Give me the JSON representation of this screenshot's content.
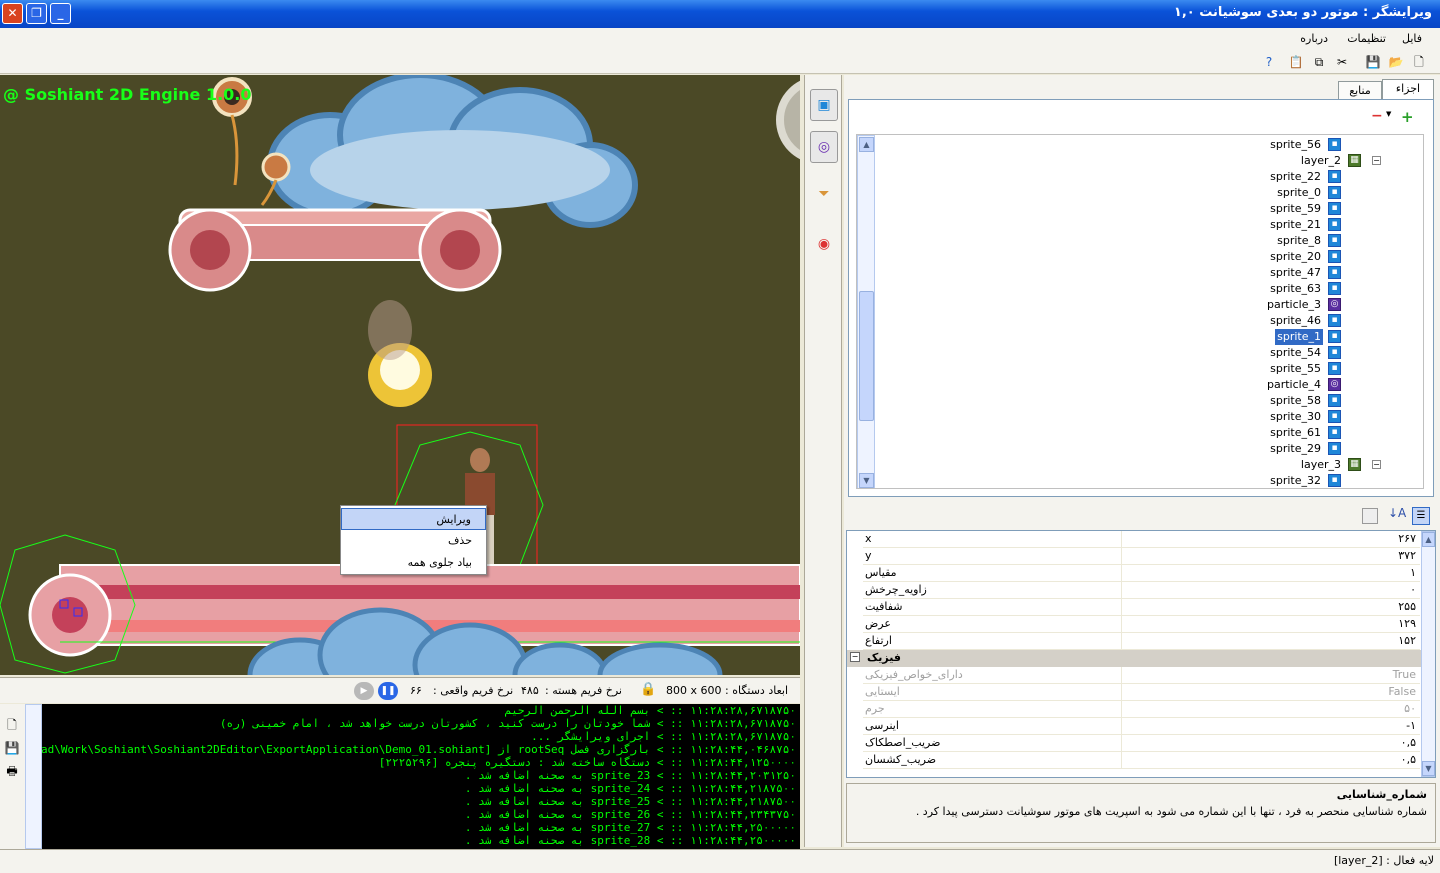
{
  "window": {
    "title": "ویرایشگر : موتور دو بعدی سوشیانت ۱,۰"
  },
  "menu": {
    "file": "فایل",
    "settings": "تنظیمات",
    "about": "درباره"
  },
  "canvas": {
    "engine_label": "@ Soshiant 2D Engine 1.0.0",
    "background": "#4b4926"
  },
  "context_menu": {
    "edit": "ویرایش",
    "delete": "حذف",
    "bring_front": "بیاد جلوی همه"
  },
  "status": {
    "device_label": "ابعاد دستگاه :",
    "device_size": "800 x 600",
    "core_rate_label": "نرخ فریم هسته :",
    "core_rate": "۴۸۵",
    "real_rate_label": "نرخ فریم واقعی :",
    "real_rate": "۶۶"
  },
  "console": {
    "lines": [
      "۱۱:۲۸:۲۸,۶۷۱۸۷۵۰ :: > بسم الله الرحمن الرحیم",
      "۱۱:۲۸:۲۸,۶۷۱۸۷۵۰ :: > شما خودتان را درست کنید ، کشورتان درست خواهد شد ، امام خمینی (ره)",
      "۱۱:۲۸:۲۸,۶۷۱۸۷۵۰ :: > اجرای ویرایشگر ...",
      "۱۱:۲۸:۴۴,۰۴۶۸۷۵۰ :: > بارگزاری فصل rootSeq از [K:\\Sajjad\\Work\\Soshiant\\Soshiant2DEditor\\ExportApplication\\Demo_01.sohiant]",
      "۱۱:۲۸:۴۴,۱۲۵۰۰۰۰ :: > دستگاه ساخته شد : دستگیره پنجره [۲۲۲۵۲۹۶]",
      "۱۱:۲۸:۴۴,۲۰۳۱۲۵۰ :: > sprite_23 به صحنه اضافه شد .",
      "۱۱:۲۸:۴۴,۲۱۸۷۵۰۰ :: > sprite_24 به صحنه اضافه شد .",
      "۱۱:۲۸:۴۴,۲۱۸۷۵۰۰ :: > sprite_25 به صحنه اضافه شد .",
      "۱۱:۲۸:۴۴,۲۳۴۳۷۵۰ :: > sprite_26 به صحنه اضافه شد .",
      "۱۱:۲۸:۴۴,۲۵۰۰۰۰۰ :: > sprite_27 به صحنه اضافه شد .",
      "۱۱:۲۸:۴۴,۲۵۰۰۰۰۰ :: > sprite_28 به صحنه اضافه شد ."
    ]
  },
  "tabs": {
    "parts": "اجزاء",
    "resources": "منابع"
  },
  "tree": {
    "items": [
      {
        "label": "sprite_56",
        "icon": "sprite-icon"
      },
      {
        "label": "layer_2",
        "icon": "layer-icon"
      },
      {
        "label": "sprite_22",
        "icon": "sprite-icon"
      },
      {
        "label": "sprite_0",
        "icon": "sprite-icon"
      },
      {
        "label": "sprite_59",
        "icon": "sprite-icon"
      },
      {
        "label": "sprite_21",
        "icon": "sprite-icon"
      },
      {
        "label": "sprite_8",
        "icon": "sprite-icon"
      },
      {
        "label": "sprite_20",
        "icon": "sprite-icon"
      },
      {
        "label": "sprite_47",
        "icon": "sprite-icon"
      },
      {
        "label": "sprite_63",
        "icon": "sprite-icon"
      },
      {
        "label": "particle_3",
        "icon": "particle-icon"
      },
      {
        "label": "sprite_46",
        "icon": "sprite-icon"
      },
      {
        "label": "sprite_1",
        "icon": "sprite-icon",
        "selected": true
      },
      {
        "label": "sprite_54",
        "icon": "sprite-icon"
      },
      {
        "label": "sprite_55",
        "icon": "sprite-icon"
      },
      {
        "label": "particle_4",
        "icon": "particle-icon"
      },
      {
        "label": "sprite_58",
        "icon": "sprite-icon"
      },
      {
        "label": "sprite_30",
        "icon": "sprite-icon"
      },
      {
        "label": "sprite_61",
        "icon": "sprite-icon"
      },
      {
        "label": "sprite_29",
        "icon": "sprite-icon"
      },
      {
        "label": "layer_3",
        "icon": "layer-icon"
      },
      {
        "label": "sprite_32",
        "icon": "sprite-icon"
      }
    ]
  },
  "properties": {
    "rows": [
      {
        "name": "x",
        "value": "۲۶۷"
      },
      {
        "name": "y",
        "value": "۳۷۲"
      },
      {
        "name": "مقیاس",
        "value": "۱"
      },
      {
        "name": "زاویه_چرخش",
        "value": "۰"
      },
      {
        "name": "شفافیت",
        "value": "۲۵۵"
      },
      {
        "name": "عرض",
        "value": "۱۲۹"
      },
      {
        "name": "ارتفاع",
        "value": "۱۵۲"
      }
    ],
    "physics_header": "فیزیک",
    "physics_rows": [
      {
        "name": "دارای_خواص_فیزیکی",
        "value": "True",
        "disabled": true
      },
      {
        "name": "ایستایی",
        "value": "False",
        "disabled": true
      },
      {
        "name": "جرم",
        "value": "۵۰",
        "disabled": true
      },
      {
        "name": "اینرسی",
        "value": "۱-",
        "disabled": false
      },
      {
        "name": "ضریب_اصطکاک",
        "value": "۰,۵",
        "disabled": false
      },
      {
        "name": "ضریب_کشسان",
        "value": "۰,۵",
        "disabled": false
      }
    ]
  },
  "description": {
    "title": "شماره_شناسایی",
    "text": "شماره شناسایی منحصر به فرد ، تنها با این شماره می شود به اسپریت های موتور سوشیانت دسترسی پیدا کرد ."
  },
  "bottom": {
    "active_layer": "لایه فعال : [layer_2]"
  }
}
